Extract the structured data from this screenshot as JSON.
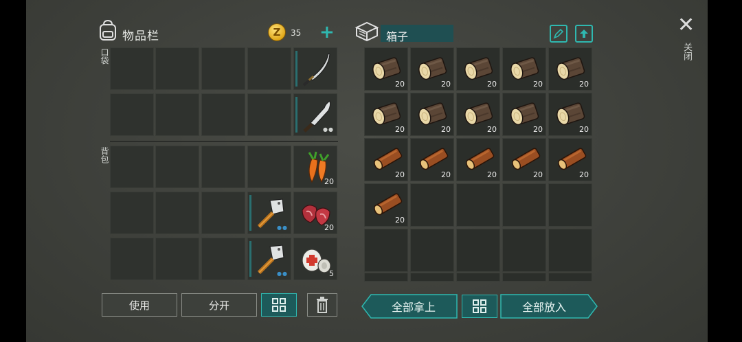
{
  "inventory": {
    "title": "物品栏",
    "coins": "35",
    "pocket_label": "口袋",
    "backpack_label": "背包",
    "pocket_items": [
      {
        "slot": 4,
        "row": 0,
        "icon": "katana-icon",
        "qty": "",
        "dots": ""
      },
      {
        "slot": 4,
        "row": 1,
        "icon": "machete-icon",
        "qty": "",
        "dots": "●●"
      }
    ],
    "backpack_items": [
      {
        "icon": "carrot-icon",
        "qty": "20"
      },
      {
        "icon": "raw-meat-icon",
        "qty": "20"
      },
      {
        "icon": "bandage-icon",
        "qty": "5"
      }
    ],
    "cleavers": [
      "●●",
      "●●"
    ]
  },
  "container": {
    "name": "箱子",
    "slots": [
      {
        "icon": "log-icon",
        "qty": "20"
      },
      {
        "icon": "log-icon",
        "qty": "20"
      },
      {
        "icon": "log-icon",
        "qty": "20"
      },
      {
        "icon": "log-icon",
        "qty": "20"
      },
      {
        "icon": "log-icon",
        "qty": "20"
      },
      {
        "icon": "log-icon",
        "qty": "20"
      },
      {
        "icon": "log-icon",
        "qty": "20"
      },
      {
        "icon": "log-icon",
        "qty": "20"
      },
      {
        "icon": "log-icon",
        "qty": "20"
      },
      {
        "icon": "log-icon",
        "qty": "20"
      },
      {
        "icon": "plank-icon",
        "qty": "20"
      },
      {
        "icon": "plank-icon",
        "qty": "20"
      },
      {
        "icon": "plank-icon",
        "qty": "20"
      },
      {
        "icon": "plank-icon",
        "qty": "20"
      },
      {
        "icon": "plank-icon",
        "qty": "20"
      },
      {
        "icon": "plank-icon",
        "qty": "20"
      }
    ]
  },
  "buttons": {
    "use": "使用",
    "split": "分开",
    "take_all": "全部拿上",
    "put_all": "全部放入"
  },
  "close_label": "关闭",
  "colors": {
    "accent": "#2fb8b0",
    "durability": "#2a6f70",
    "dots": "#3a8fc7"
  }
}
